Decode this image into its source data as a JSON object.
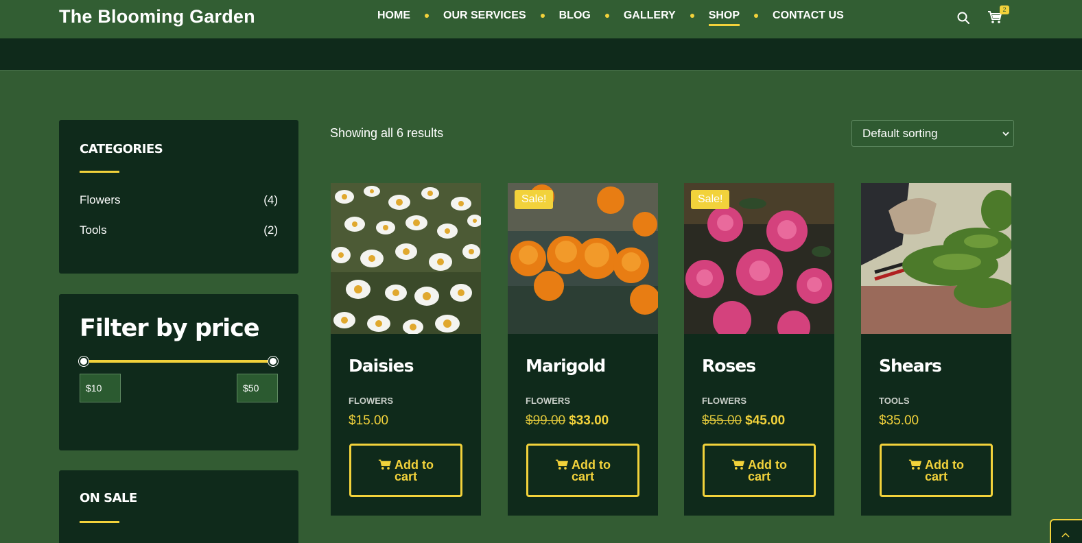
{
  "header": {
    "logo": "The Blooming Garden",
    "nav": [
      "HOME",
      "OUR SERVICES",
      "BLOG",
      "GALLERY",
      "SHOP",
      "CONTACT US"
    ],
    "active_nav": "SHOP",
    "cart_count": "2"
  },
  "sidebar": {
    "categories_title": "CATEGORIES",
    "categories": [
      {
        "name": "Flowers",
        "count": "(4)"
      },
      {
        "name": "Tools",
        "count": "(2)"
      }
    ],
    "price_filter_title": "Filter by price",
    "min_price": "$10",
    "max_price": "$50",
    "on_sale_title": "ON SALE"
  },
  "main": {
    "result_count": "Showing all 6 results",
    "sort_label": "Default sorting",
    "products": [
      {
        "name": "Daisies",
        "category": "FLOWERS",
        "price": "$15.00",
        "old_price": "",
        "sale": "",
        "button": "Add to cart",
        "image": "daisies-photo"
      },
      {
        "name": "Marigold",
        "category": "FLOWERS",
        "price": "$33.00",
        "old_price": "$99.00",
        "sale": "Sale!",
        "button": "Add to cart",
        "image": "marigold-photo"
      },
      {
        "name": "Roses",
        "category": "FLOWERS",
        "price": "$45.00",
        "old_price": "$55.00",
        "sale": "Sale!",
        "button": "Add to cart",
        "image": "roses-photo"
      },
      {
        "name": "Shears",
        "category": "TOOLS",
        "price": "$35.00",
        "old_price": "",
        "sale": "",
        "button": "Add to cart",
        "image": "shears-photo"
      }
    ]
  },
  "colors": {
    "header_bg": "#325e33",
    "page_bg": "#335c33",
    "panel_bg": "#0f2a1b",
    "accent": "#f2d23b"
  }
}
